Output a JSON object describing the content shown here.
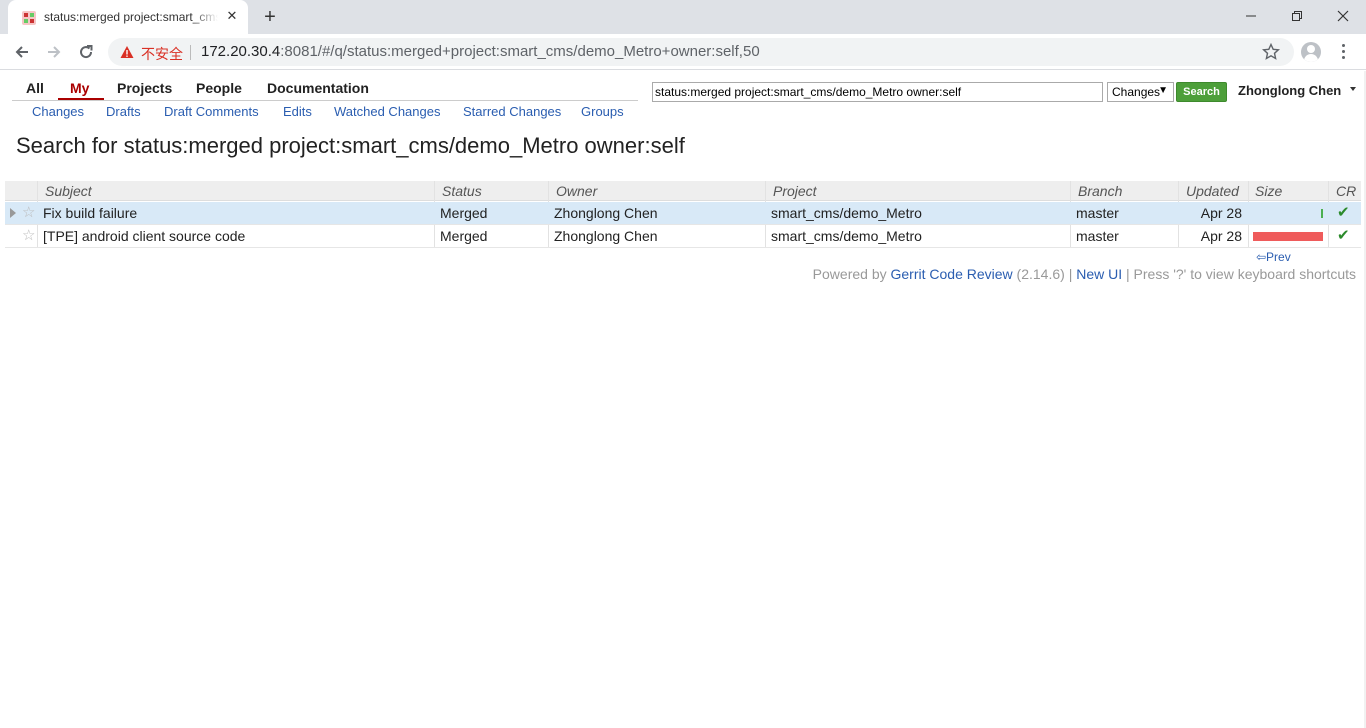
{
  "browser": {
    "tab_title": "status:merged project:smart_cms/demo_Metro owner:self",
    "insecure_label": "不安全",
    "url_host": "172.20.30.4",
    "url_rest": ":8081/#/q/status:merged+project:smart_cms/demo_Metro+owner:self,50"
  },
  "gerrit": {
    "top_menu": [
      "All",
      "My",
      "Projects",
      "People",
      "Documentation"
    ],
    "selected_menu": "My",
    "sub_menu": [
      "Changes",
      "Drafts",
      "Draft Comments",
      "Edits",
      "Watched Changes",
      "Starred Changes",
      "Groups"
    ],
    "search": {
      "query": "status:merged project:smart_cms/demo_Metro owner:self",
      "scope": "Changes",
      "button": "Search"
    },
    "user": "Zhonglong Chen",
    "page_title": "Search for status:merged project:smart_cms/demo_Metro owner:self"
  },
  "table": {
    "columns": [
      "Subject",
      "Status",
      "Owner",
      "Project",
      "Branch",
      "Updated",
      "Size",
      "CR"
    ],
    "rows": [
      {
        "subject": "Fix build failure",
        "status": "Merged",
        "owner": "Zhonglong Chen",
        "project": "smart_cms/demo_Metro",
        "branch": "master",
        "updated": "Apr 28",
        "size_fraction": 0.03,
        "size_color": "#4caf50",
        "cr": "approved"
      },
      {
        "subject": "[TPE] android client source code",
        "status": "Merged",
        "owner": "Zhonglong Chen",
        "project": "smart_cms/demo_Metro",
        "branch": "master",
        "updated": "Apr 28",
        "size_fraction": 1.0,
        "size_color": "#ef5b5b",
        "cr": "approved"
      }
    ],
    "prev_label": "⇦Prev"
  },
  "footer": {
    "powered_by": "Powered by",
    "gerrit_link": "Gerrit Code Review",
    "version": "(2.14.6)",
    "sep": "|",
    "new_ui": "New UI",
    "shortcuts": "Press '?' to view keyboard shortcuts"
  },
  "colors": {
    "accent": "#aa0000",
    "link": "#2a5db0",
    "search_button": "#4d9f3a",
    "active_row": "#d8e9f7"
  }
}
